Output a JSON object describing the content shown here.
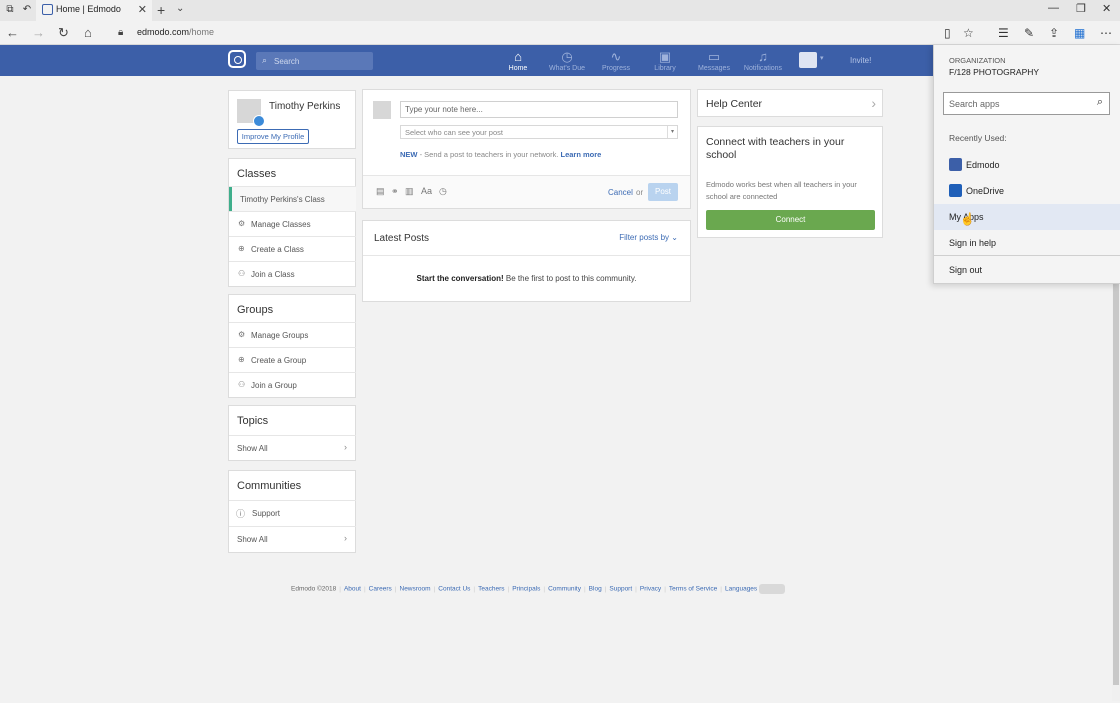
{
  "browser": {
    "tab_title": "Home | Edmodo",
    "url_host": "edmodo.com",
    "url_path": "/home"
  },
  "nav": {
    "search_placeholder": "Search",
    "items": [
      {
        "label": "Home",
        "icon": "home-icon"
      },
      {
        "label": "What's Due",
        "icon": "clock-icon"
      },
      {
        "label": "Progress",
        "icon": "pulse-icon"
      },
      {
        "label": "Library",
        "icon": "library-icon"
      },
      {
        "label": "Messages",
        "icon": "chat-icon"
      },
      {
        "label": "Notifications",
        "icon": "bell-icon"
      }
    ],
    "invite": "Invite!"
  },
  "profile": {
    "name": "Timothy Perkins",
    "improve_label": "Improve My Profile"
  },
  "classes": {
    "title": "Classes",
    "items": [
      {
        "label": "Timothy Perkins's Class"
      },
      {
        "label": "Manage Classes"
      },
      {
        "label": "Create a Class"
      },
      {
        "label": "Join a Class"
      }
    ]
  },
  "groups": {
    "title": "Groups",
    "items": [
      {
        "label": "Manage Groups"
      },
      {
        "label": "Create a Group"
      },
      {
        "label": "Join a Group"
      }
    ]
  },
  "topics": {
    "title": "Topics",
    "show_all": "Show All"
  },
  "communities": {
    "title": "Communities",
    "support": "Support",
    "show_all": "Show All"
  },
  "composer": {
    "note_placeholder": "Type your note here...",
    "audience_placeholder": "Select who can see your post",
    "new_label": "NEW",
    "info_text": " - Send a post to teachers in your network. ",
    "learn_more": "Learn more",
    "cancel": "Cancel",
    "or": "or",
    "post": "Post"
  },
  "latest_posts": {
    "title": "Latest Posts",
    "filter": "Filter posts by",
    "msg_bold": "Start the conversation!",
    "msg_rest": " Be the first to post to this community."
  },
  "help_center": {
    "title": "Help Center"
  },
  "connect_card": {
    "title": "Connect with teachers in your school",
    "description": "Edmodo works best when all teachers in your school are connected",
    "button": "Connect"
  },
  "footer": {
    "copyright": "Edmodo ©2018",
    "links": [
      "About",
      "Careers",
      "Newsroom",
      "Contact Us",
      "Teachers",
      "Principals",
      "Community",
      "Blog",
      "Support",
      "Privacy",
      "Terms of Service",
      "Languages"
    ]
  },
  "apps_flyout": {
    "org_label": "ORGANIZATION",
    "org_name": "F/128 PHOTOGRAPHY",
    "search_placeholder": "Search apps",
    "recently_used": "Recently Used:",
    "apps": [
      {
        "label": "Edmodo",
        "color": "#3c5fa8"
      },
      {
        "label": "OneDrive",
        "color": "#1f5fb8"
      }
    ],
    "my_apps": "My Apps",
    "sign_in_help": "Sign in help",
    "sign_out": "Sign out"
  },
  "colors": {
    "brand_blue": "#3c5fa8",
    "accent_green": "#6aa84f",
    "active_class_bar": "#3fae8b"
  }
}
